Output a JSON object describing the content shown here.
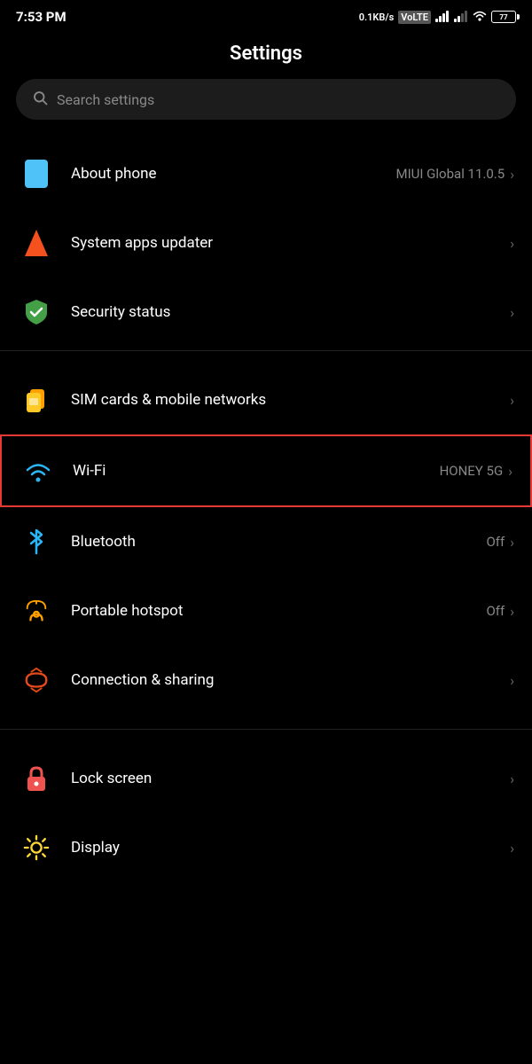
{
  "statusBar": {
    "time": "7:53 PM",
    "speed": "0.1KB/s",
    "networkType": "VoLTE",
    "wifi": true,
    "battery": "77"
  },
  "pageTitle": "Settings",
  "search": {
    "placeholder": "Search settings"
  },
  "sections": [
    {
      "id": "top",
      "items": [
        {
          "id": "about-phone",
          "label": "About phone",
          "value": "MIUI Global 11.0.5",
          "icon": "phone-icon",
          "chevron": "›"
        },
        {
          "id": "system-apps-updater",
          "label": "System apps updater",
          "value": "",
          "icon": "arrow-up-icon",
          "chevron": "›"
        },
        {
          "id": "security-status",
          "label": "Security status",
          "value": "",
          "icon": "shield-icon",
          "chevron": "›"
        }
      ]
    },
    {
      "id": "network",
      "items": [
        {
          "id": "sim-cards",
          "label": "SIM cards & mobile networks",
          "value": "",
          "icon": "sim-icon",
          "chevron": "›"
        },
        {
          "id": "wifi",
          "label": "Wi-Fi",
          "value": "HONEY 5G",
          "icon": "wifi-icon",
          "chevron": "›",
          "highlighted": true
        },
        {
          "id": "bluetooth",
          "label": "Bluetooth",
          "value": "Off",
          "icon": "bluetooth-icon",
          "chevron": "›"
        },
        {
          "id": "portable-hotspot",
          "label": "Portable hotspot",
          "value": "Off",
          "icon": "hotspot-icon",
          "chevron": "›"
        },
        {
          "id": "connection-sharing",
          "label": "Connection & sharing",
          "value": "",
          "icon": "connection-icon",
          "chevron": "›"
        }
      ]
    },
    {
      "id": "device",
      "items": [
        {
          "id": "lock-screen",
          "label": "Lock screen",
          "value": "",
          "icon": "lock-icon",
          "chevron": "›"
        },
        {
          "id": "display",
          "label": "Display",
          "value": "",
          "icon": "display-icon",
          "chevron": "›"
        }
      ]
    }
  ]
}
